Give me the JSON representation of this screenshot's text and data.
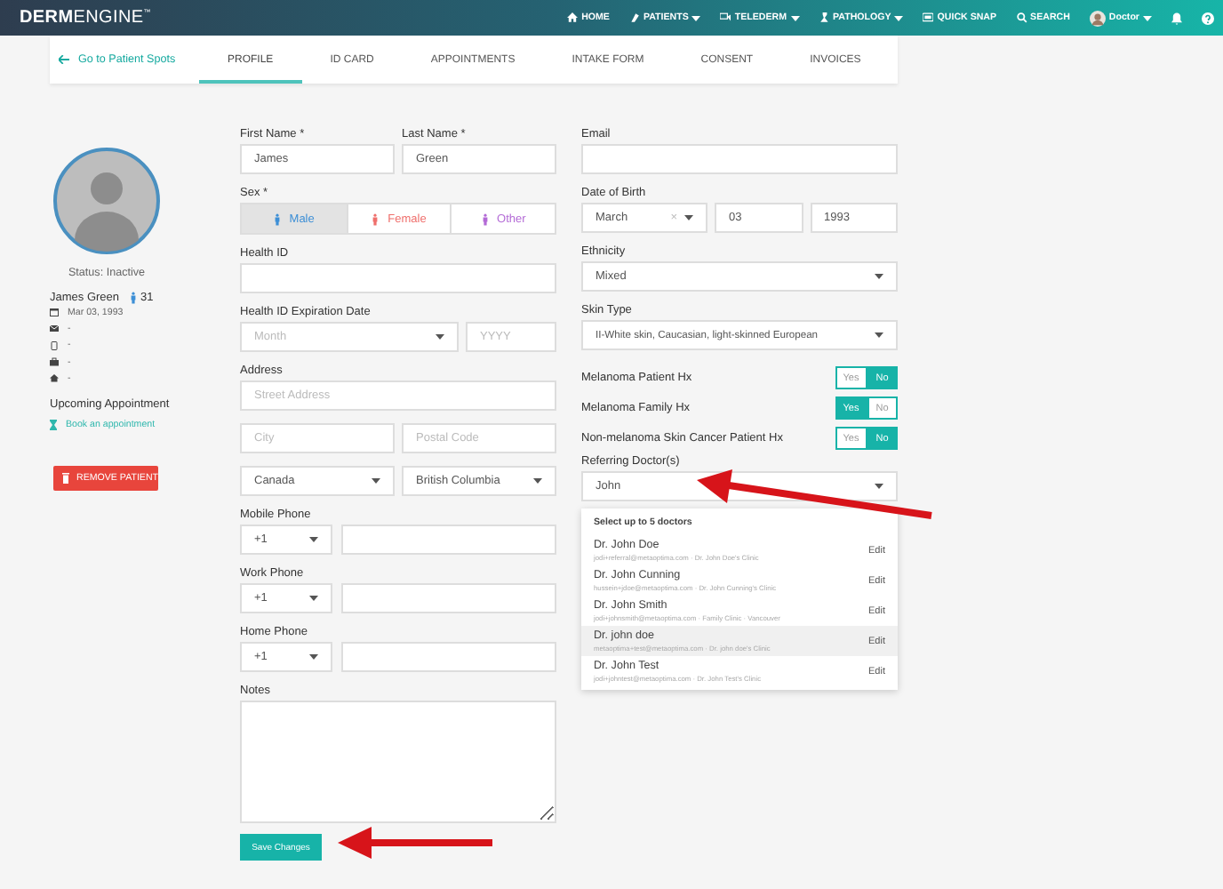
{
  "header": {
    "logo": "**DERM**ENGINE$^{™}$",
    "nav": [
      {
        "label": "HOME",
        "dropdown": false
      },
      {
        "label": "PATIENTS",
        "dropdown": true
      },
      {
        "label": "TELEDERM",
        "dropdown": true
      },
      {
        "label": "PATHOLOGY",
        "dropdown": true
      },
      {
        "label": "QUICK SNAP",
        "dropdown": false
      },
      {
        "label": "SEARCH",
        "dropdown": false
      }
    ],
    "user": {
      "label": "Doctor",
      "dropdown": true
    }
  },
  "tab_bar": {
    "back_link": "Go to Patient Spots",
    "tabs": [
      {
        "label": "PROFILE",
        "selected": true
      },
      {
        "label": "ID CARD",
        "selected": false
      },
      {
        "label": "APPOINTMENTS",
        "selected": false
      },
      {
        "label": "INTAKE FORM",
        "selected": false
      },
      {
        "label": "CONSENT",
        "selected": false
      },
      {
        "label": "INVOICES",
        "selected": false
      }
    ]
  },
  "sidebar": {
    "status": "Status: Inactive",
    "name": "James Green",
    "age": "31",
    "birth_date": "Mar 03, 1993",
    "contacts": [
      "-",
      "-",
      "-",
      "-"
    ],
    "upcoming_title": "Upcoming Appointment",
    "book_link": "Book an appointment",
    "remove_button": "REMOVE PATIENT"
  },
  "form_left": {
    "first_name": {
      "label": "First Name *",
      "value": "James"
    },
    "last_name": {
      "label": "Last Name *",
      "value": "Green"
    },
    "sex": {
      "label": "Sex *",
      "options": [
        {
          "label": "Male",
          "selected": true,
          "color": "#3d8fd6"
        },
        {
          "label": "Female",
          "selected": false,
          "color": "#ef6f6c"
        },
        {
          "label": "Other",
          "selected": false,
          "color": "#b36ad6"
        }
      ]
    },
    "health_id": {
      "label": "Health ID"
    },
    "expiration": {
      "label": "Health ID Expiration Date",
      "month_placeholder": "Month",
      "year_placeholder": "YYYY"
    },
    "address": {
      "label": "Address",
      "street_placeholder": "Street Address",
      "city_placeholder": "City",
      "postal_placeholder": "Postal Code",
      "country": "Canada",
      "province": "British Columbia"
    },
    "phones": [
      {
        "label": "Mobile Phone",
        "code": "+1"
      },
      {
        "label": "Work Phone",
        "code": "+1"
      },
      {
        "label": "Home Phone",
        "code": "+1"
      }
    ],
    "notes": {
      "label": "Notes"
    },
    "save_button": "Save Changes"
  },
  "form_right": {
    "email": {
      "label": "Email"
    },
    "date_of_birth": {
      "label": "Date of Birth",
      "month": "March",
      "clear": "×",
      "day": "03",
      "year": "1993"
    },
    "ethnicity": {
      "label": "Ethnicity",
      "value": "Mixed"
    },
    "skin_type": {
      "label": "Skin Type",
      "value": "II-White skin, Caucasian, light-skinned European"
    },
    "history": [
      {
        "label": "Melanoma Patient Hx",
        "options": [
          {
            "label": "Yes",
            "selected": false
          },
          {
            "label": "No",
            "selected": true
          }
        ]
      },
      {
        "label": "Melanoma Family Hx",
        "options": [
          {
            "label": "Yes",
            "selected": true
          },
          {
            "label": "No",
            "selected": false
          }
        ]
      },
      {
        "label": "Non-melanoma Skin Cancer Patient Hx",
        "options": [
          {
            "label": "Yes",
            "selected": false
          },
          {
            "label": "No",
            "selected": true
          }
        ]
      }
    ],
    "referring": {
      "label": "Referring Doctor(s)",
      "value": "John",
      "heading": "Select up to 5 doctors",
      "doctors": [
        {
          "name": "Dr. John Doe",
          "detail": "jodi+referral@metaoptima.com · Dr. John Doe's Clinic",
          "action": "Edit",
          "selected": false
        },
        {
          "name": "Dr. John Cunning",
          "detail": "hussein+jdoe@metaoptima.com · Dr. John Cunning's Clinic",
          "action": "Edit",
          "selected": false
        },
        {
          "name": "Dr. John Smith",
          "detail": "jodi+johnsmith@metaoptima.com · Family Clinic · Vancouver",
          "action": "Edit",
          "selected": false
        },
        {
          "name": "Dr. john doe",
          "detail": "metaoptima+test@metaoptima.com · Dr. john doe's Clinic",
          "action": "Edit",
          "selected": true
        },
        {
          "name": "Dr. John Test",
          "detail": "jodi+johntest@metaoptima.com · Dr. John Test's Clinic",
          "action": "Edit",
          "selected": false
        }
      ]
    }
  }
}
